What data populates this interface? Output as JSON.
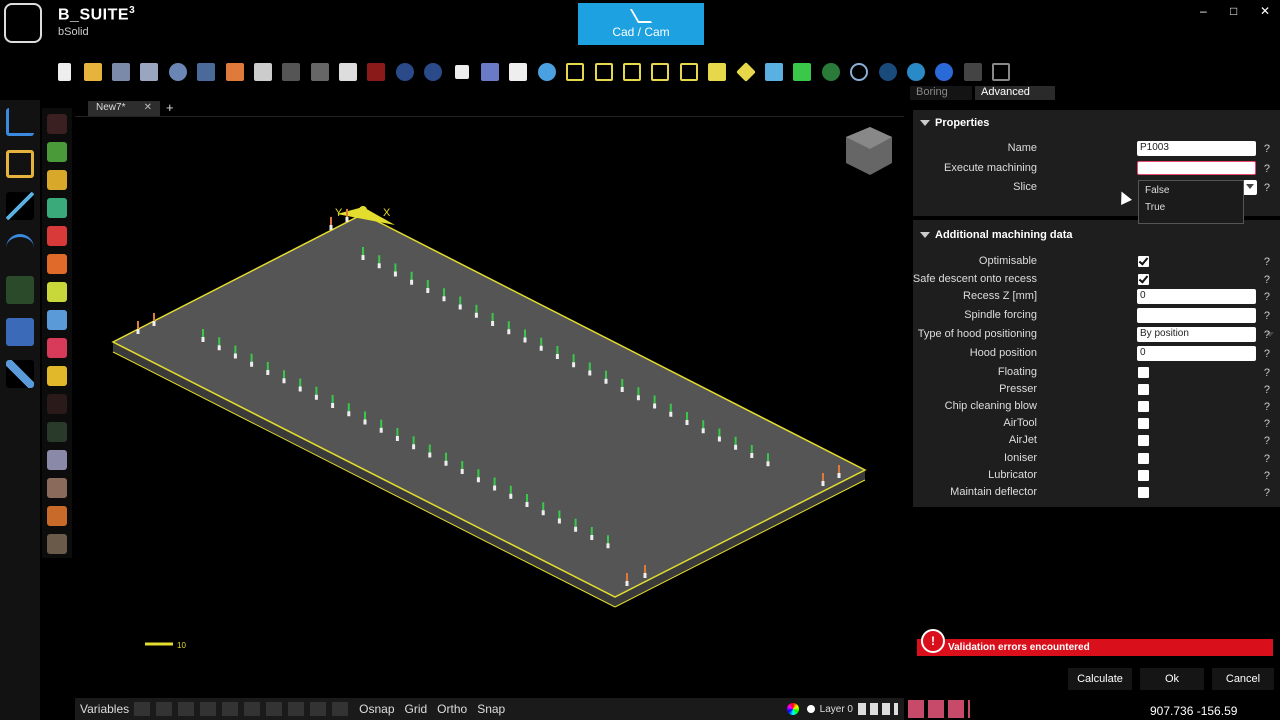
{
  "app": {
    "title": "B_SUITE",
    "title_sup": "3",
    "subtitle": "bSolid"
  },
  "mode_button": {
    "label": "Cad / Cam"
  },
  "window_controls": {
    "minimize": "–",
    "restore": "□",
    "close": "✕"
  },
  "doc_tab": {
    "label": "New7*",
    "close": "✕",
    "add": "+"
  },
  "scale_label": "10",
  "axes": {
    "x": "X",
    "y": "Y"
  },
  "panel_tabs": {
    "boring": "Boring",
    "advanced": "Advanced"
  },
  "properties": {
    "title": "Properties",
    "name_label": "Name",
    "name_value": "P1003",
    "execute_label": "Execute machining",
    "execute_value": "",
    "slice_label": "Slice"
  },
  "dropdown_options": [
    "False",
    "True"
  ],
  "additional": {
    "title": "Additional machining data",
    "rows": [
      {
        "label": "Optimisable",
        "type": "checkbox",
        "checked": true
      },
      {
        "label": "Safe descent onto recess",
        "type": "checkbox",
        "checked": true
      },
      {
        "label": "Recess Z  [mm]",
        "type": "input",
        "value": "0"
      },
      {
        "label": "Spindle forcing",
        "type": "input",
        "value": ""
      },
      {
        "label": "Type of hood positioning",
        "type": "select",
        "value": "By position"
      },
      {
        "label": "Hood position",
        "type": "input",
        "value": "0"
      },
      {
        "label": "Floating",
        "type": "checkbox",
        "checked": false
      },
      {
        "label": "Presser",
        "type": "checkbox",
        "checked": false
      },
      {
        "label": "Chip cleaning blow",
        "type": "checkbox",
        "checked": false
      },
      {
        "label": "AirTool",
        "type": "checkbox",
        "checked": false
      },
      {
        "label": "AirJet",
        "type": "checkbox",
        "checked": false
      },
      {
        "label": "Ioniser",
        "type": "checkbox",
        "checked": false
      },
      {
        "label": "Lubricator",
        "type": "checkbox",
        "checked": false
      },
      {
        "label": "Maintain deflector",
        "type": "checkbox",
        "checked": false
      }
    ]
  },
  "help_mark": "?",
  "error": {
    "badge": "!",
    "text": "Validation errors encountered"
  },
  "buttons": {
    "calculate": "Calculate",
    "ok": "Ok",
    "cancel": "Cancel"
  },
  "status": {
    "variables": "Variables",
    "osnap": "Osnap",
    "grid": "Grid",
    "ortho": "Ortho",
    "snap": "Snap",
    "layer": "Layer 0"
  },
  "coords": "907.736 -156.59",
  "colors": {
    "accent": "#1da1e0",
    "error": "#d90f1c",
    "board_outline": "#e3dd2e"
  }
}
